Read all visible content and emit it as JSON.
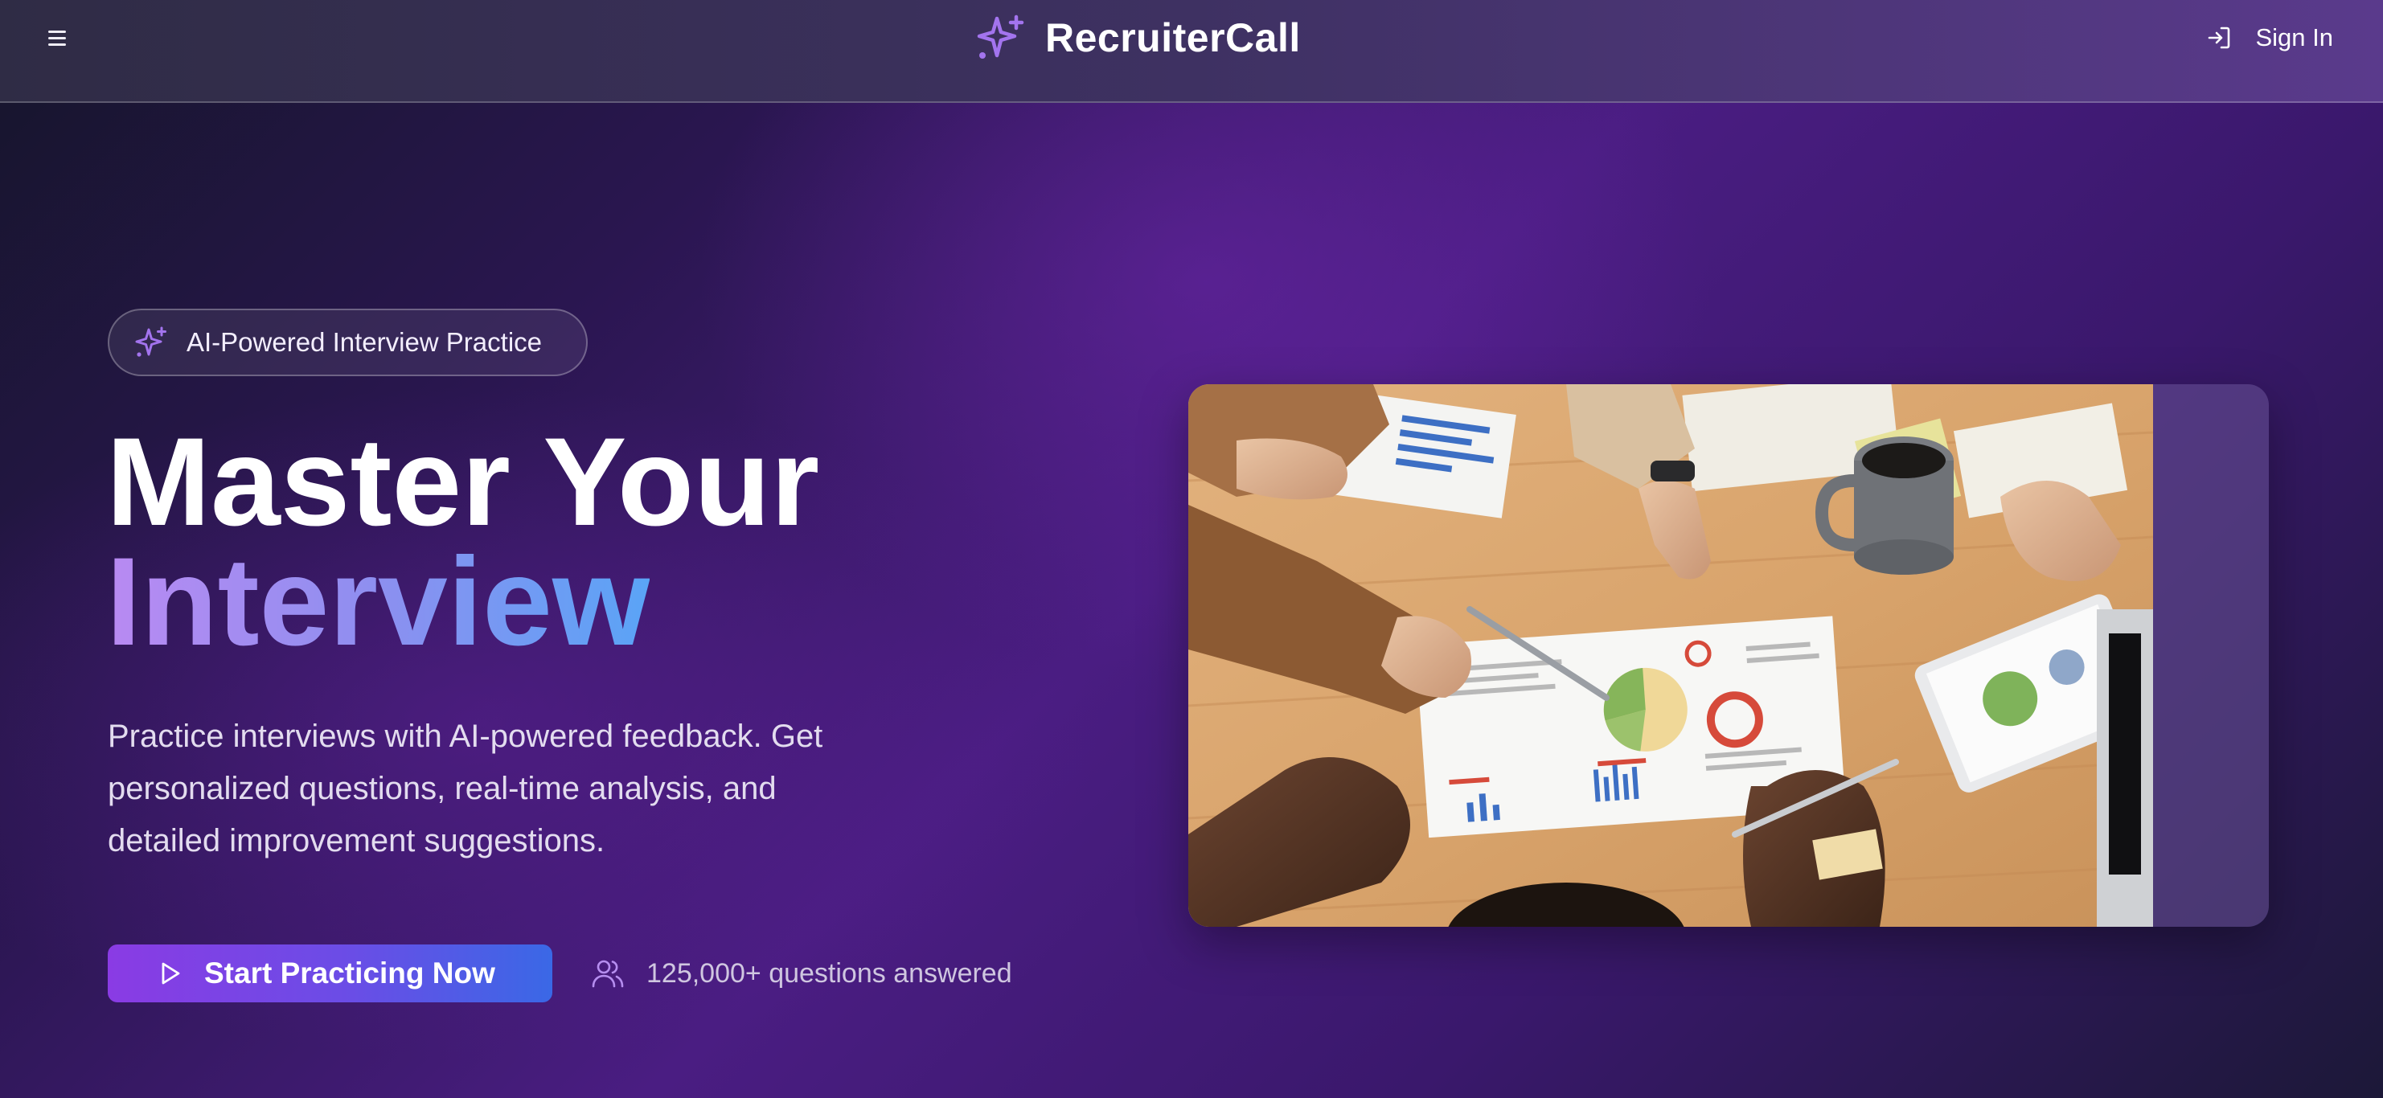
{
  "header": {
    "menu_icon": "hamburger-menu-icon",
    "brand": {
      "name": "RecruiterCall",
      "icon": "sparkles-icon",
      "accent": "#a374ee"
    },
    "signin": {
      "label": "Sign In",
      "icon": "log-in-icon"
    }
  },
  "hero": {
    "badge": {
      "label": "AI-Powered Interview Practice",
      "icon": "sparkles-icon"
    },
    "title_line1": "Master Your",
    "title_line2": "Interview",
    "subtitle": "Practice interviews with AI-powered feedback. Get personalized questions, real-time analysis, and detailed improvement suggestions.",
    "cta": {
      "label": "Start Practicing Now",
      "icon": "play-icon"
    },
    "stat": {
      "label": "125,000+ questions answered",
      "icon": "users-icon"
    },
    "image": {
      "subject": "team-meeting-with-charts-photo"
    }
  },
  "colors": {
    "title_gradient": [
      "#b98af2",
      "#5aa4f6"
    ],
    "cta_gradient": [
      "#8a3be4",
      "#3a68e6"
    ],
    "background": "#3b1a6e"
  }
}
